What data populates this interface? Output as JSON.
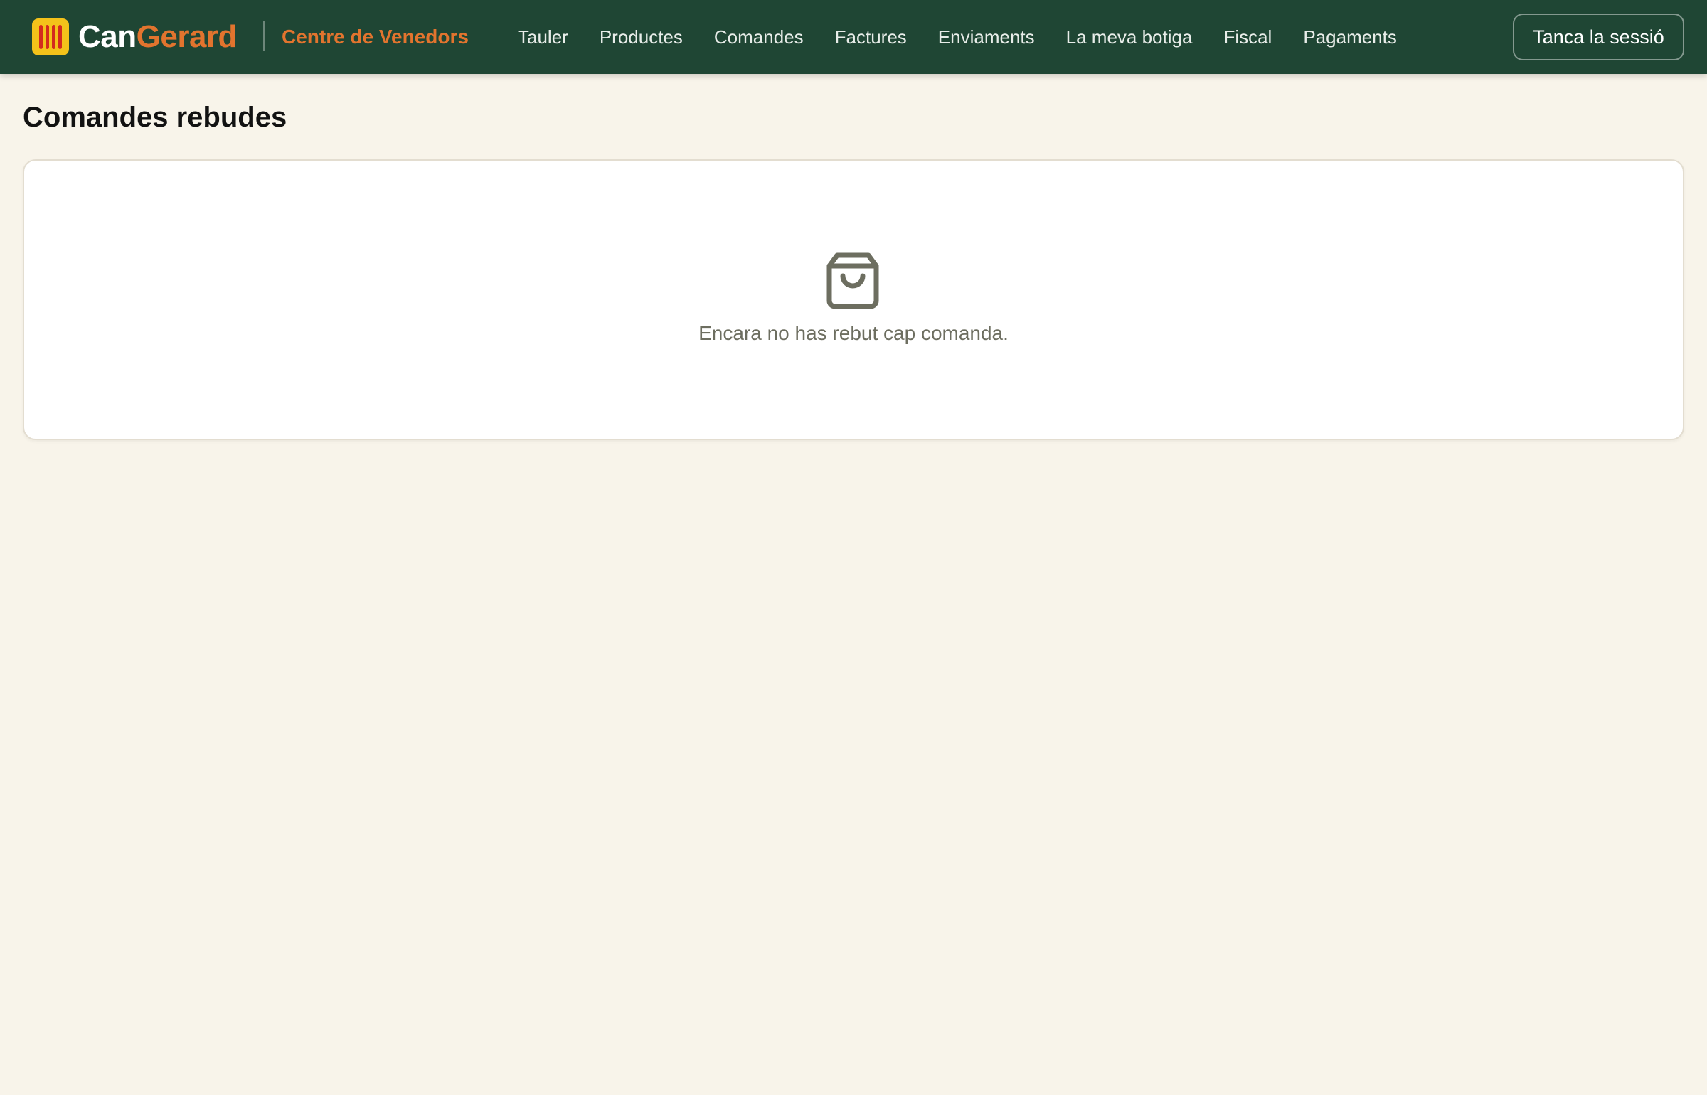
{
  "brand": {
    "name_part_a": "Can",
    "name_part_b": "Gerard",
    "logo_icon": "senyera-flag-icon",
    "colors": {
      "logo_background": "#f4c21a",
      "logo_stripes": "#d42a1e",
      "accent": "#e2742e"
    }
  },
  "header": {
    "section_title": "Centre de Venedors",
    "background": "#1f4634",
    "nav": [
      {
        "label": "Tauler"
      },
      {
        "label": "Productes"
      },
      {
        "label": "Comandes"
      },
      {
        "label": "Factures"
      },
      {
        "label": "Enviaments"
      },
      {
        "label": "La meva botiga"
      },
      {
        "label": "Fiscal"
      },
      {
        "label": "Pagaments"
      }
    ],
    "logout_label": "Tanca la sessió"
  },
  "main": {
    "title": "Comandes rebudes",
    "empty_state": {
      "icon": "shopping-bag-icon",
      "message": "Encara no has rebut cap comanda."
    }
  }
}
